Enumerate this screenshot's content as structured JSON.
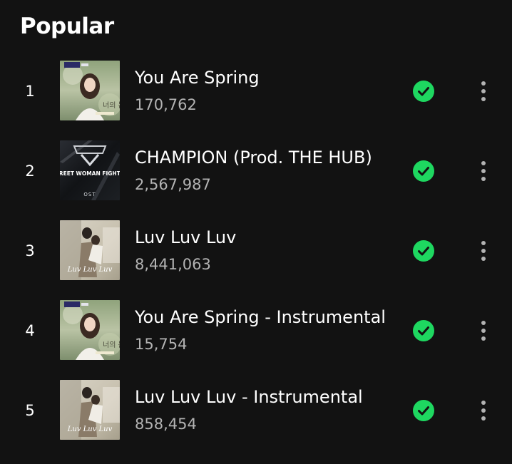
{
  "section": {
    "title": "Popular"
  },
  "tracks": [
    {
      "rank": "1",
      "title": "You Are Spring",
      "plays": "170,762",
      "art": "spring-single",
      "downloaded": true
    },
    {
      "rank": "2",
      "title": "CHAMPION (Prod. THE HUB)",
      "plays": "2,567,987",
      "art": "street-woman-fighter",
      "art_text": "STREET WOMAN FIGHTER",
      "art_sub": "OST",
      "downloaded": true
    },
    {
      "rank": "3",
      "title": "Luv Luv Luv",
      "plays": "8,441,063",
      "art": "luv-single",
      "art_text": "Luv Luv Luv",
      "downloaded": true
    },
    {
      "rank": "4",
      "title": "You Are Spring - Instrumental",
      "plays": "15,754",
      "art": "spring-single",
      "downloaded": true
    },
    {
      "rank": "5",
      "title": "Luv Luv Luv - Instrumental",
      "plays": "858,454",
      "art": "luv-single",
      "art_text": "Luv Luv Luv",
      "downloaded": true
    }
  ],
  "icons": {
    "downloaded": "check-circle-icon",
    "more": "more-vertical-icon"
  },
  "colors": {
    "background": "#121212",
    "primary_text": "#ffffff",
    "secondary_text": "#b3b3b3",
    "accent_green": "#1ed760"
  }
}
